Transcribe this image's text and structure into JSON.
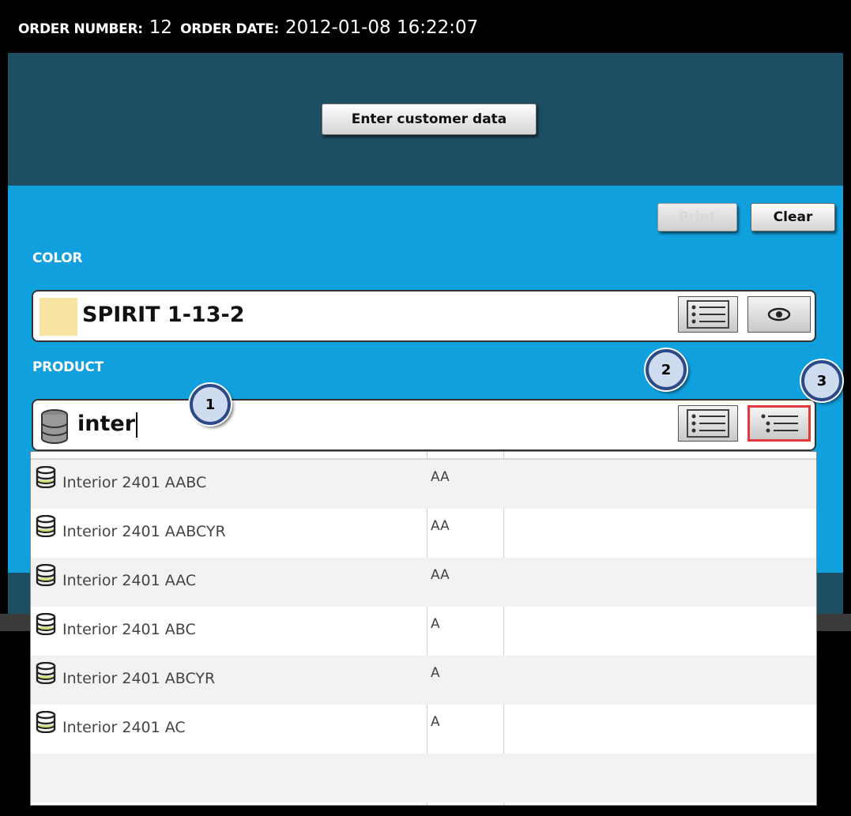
{
  "header": {
    "order_number_label": "ORDER NUMBER:",
    "order_number_value": "12",
    "order_date_label": "ORDER DATE:",
    "order_date_value": "2012-01-08 16:22:07"
  },
  "customer": {
    "enter_button": "Enter customer data"
  },
  "actions": {
    "print_label": "Print",
    "clear_label": "Clear"
  },
  "color_section": {
    "label": "COLOR",
    "value": "SPIRIT 1-13-2",
    "swatch_color": "#f7e3a3",
    "list_icon": "list-icon",
    "view_icon": "eye-icon"
  },
  "product_section": {
    "label": "PRODUCT",
    "input_value": "inter",
    "icon": "database-icon",
    "list_icon": "list-icon",
    "tree_list_icon": "tree-list-icon"
  },
  "dropdown": {
    "rows": [
      {
        "name": "Interior 2401 AABC",
        "code": "AA"
      },
      {
        "name": "Interior 2401 AABCYR",
        "code": "AA"
      },
      {
        "name": "Interior 2401 AAC",
        "code": "AA"
      },
      {
        "name": "Interior 2401 ABC",
        "code": "A"
      },
      {
        "name": "Interior 2401 ABCYR",
        "code": "A"
      },
      {
        "name": "Interior 2401 AC",
        "code": "A"
      }
    ]
  },
  "callouts": [
    "1",
    "2",
    "3"
  ],
  "colors": {
    "top_bg": "#000000",
    "dark_panel": "#1d4e63",
    "blue_panel": "#11a0de",
    "active_border": "#e23a3a",
    "callout_border": "#2b4a86"
  }
}
